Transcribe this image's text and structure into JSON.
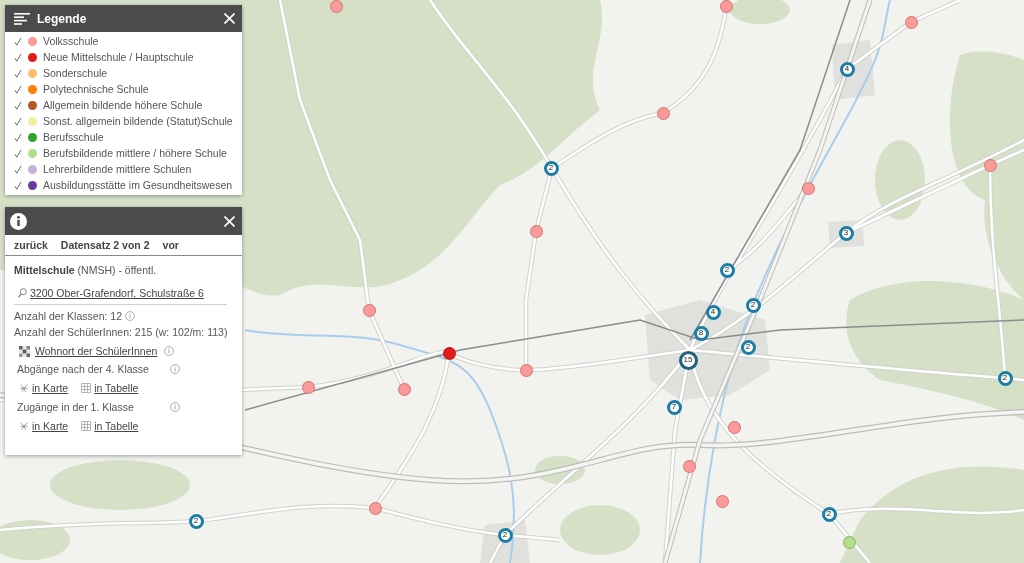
{
  "legend": {
    "title": "Legende",
    "items": [
      {
        "label": "Volksschule",
        "color": "#fb9a99",
        "checked": true
      },
      {
        "label": "Neue Mittelschule / Hauptschule",
        "color": "#e31a1c",
        "checked": true
      },
      {
        "label": "Sonderschule",
        "color": "#fdbf6f",
        "checked": true
      },
      {
        "label": "Polytechnische Schule",
        "color": "#ff7f00",
        "checked": true
      },
      {
        "label": "Allgemein bildende höhere Schule",
        "color": "#b15928",
        "checked": true
      },
      {
        "label": "Sonst. allgemein bildende (Statut)Schule",
        "color": "#f5eea0",
        "checked": true
      },
      {
        "label": "Berufsschule",
        "color": "#33a02c",
        "checked": true
      },
      {
        "label": "Berufsbildende mittlere / höhere Schule",
        "color": "#b2df8a",
        "checked": true
      },
      {
        "label": "Lehrerbildende mittlere Schulen",
        "color": "#cab2d6",
        "checked": true
      },
      {
        "label": "Ausbildungsstätte im Gesundheitswesen",
        "color": "#6a3d9a",
        "checked": true
      }
    ]
  },
  "info_panel": {
    "nav": {
      "back": "zurück",
      "record": "Datensatz 2 von 2",
      "next": "vor"
    },
    "school_type": "**Mittelschule** (NMSH) - öffentl.",
    "address": "3200 Ober-Grafendorf, Schulstraße 6",
    "facts": [
      {
        "text": "Anzahl der Klassen: 12",
        "info_icon": true
      },
      {
        "text": "Anzahl der SchülerInnen: 215 (w: 102/m: 113)",
        "info_icon": false
      }
    ],
    "residence_link": "Wohnort der SchülerInnen",
    "sections": [
      {
        "title": "Abgänge nach der 4. Klasse",
        "map_link": "in Karte",
        "table_link": "in Tabelle"
      },
      {
        "title": "Zugänge in der 1. Klasse",
        "map_link": "in Karte",
        "table_link": "in Tabelle"
      }
    ]
  },
  "map": {
    "markers": [
      {
        "kind": "school",
        "color": "#fb9a99"
      },
      {
        "kind": "school",
        "color": "#fb9a99"
      },
      {
        "kind": "school",
        "color": "#fb9a99"
      },
      {
        "kind": "cluster",
        "count": "4"
      },
      {
        "kind": "school",
        "color": "#fb9a99"
      },
      {
        "kind": "school",
        "color": "#fb9a99"
      },
      {
        "kind": "cluster",
        "count": "2"
      },
      {
        "kind": "school",
        "color": "#fb9a99"
      },
      {
        "kind": "school",
        "color": "#fb9a99"
      },
      {
        "kind": "cluster",
        "count": "3"
      },
      {
        "kind": "cluster",
        "count": "2"
      },
      {
        "kind": "cluster",
        "count": "2"
      },
      {
        "kind": "school",
        "color": "#fb9a99"
      },
      {
        "kind": "cluster",
        "count": "4"
      },
      {
        "kind": "cluster",
        "count": "8"
      },
      {
        "kind": "cluster",
        "count": "2"
      },
      {
        "kind": "school",
        "color": "#e31a1c"
      },
      {
        "kind": "cluster",
        "count": "15"
      },
      {
        "kind": "school",
        "color": "#fb9a99"
      },
      {
        "kind": "cluster",
        "count": "2"
      },
      {
        "kind": "school",
        "color": "#fb9a99"
      },
      {
        "kind": "school",
        "color": "#fb9a99"
      },
      {
        "kind": "cluster",
        "count": "7"
      },
      {
        "kind": "school",
        "color": "#fb9a99"
      },
      {
        "kind": "school",
        "color": "#fb9a99"
      },
      {
        "kind": "school",
        "color": "#fb9a99"
      },
      {
        "kind": "school",
        "color": "#fb9a99"
      },
      {
        "kind": "cluster",
        "count": "2"
      },
      {
        "kind": "cluster",
        "count": "2"
      },
      {
        "kind": "cluster",
        "count": "2"
      },
      {
        "kind": "school",
        "color": "#b2df8a"
      }
    ]
  }
}
